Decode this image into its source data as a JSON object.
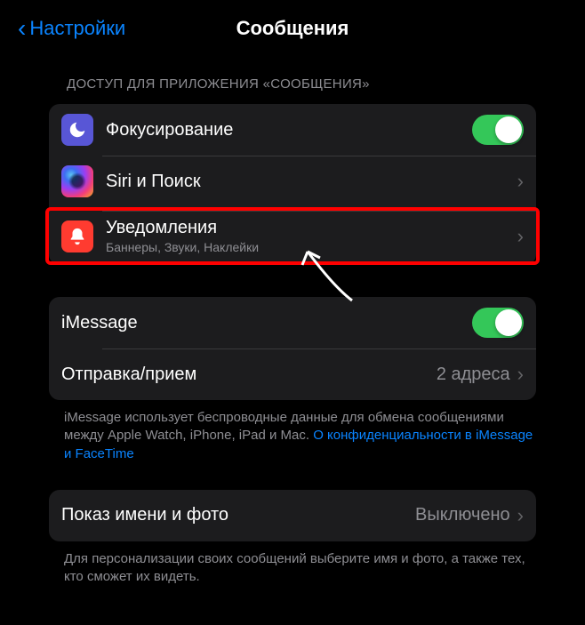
{
  "header": {
    "back_label": "Настройки",
    "title": "Сообщения"
  },
  "sections": {
    "access": {
      "header": "ДОСТУП ДЛЯ ПРИЛОЖЕНИЯ «СООБЩЕНИЯ»",
      "items": {
        "focus": {
          "label": "Фокусирование",
          "toggle_on": true
        },
        "siri": {
          "label": "Siri и Поиск"
        },
        "notifications": {
          "label": "Уведомления",
          "sublabel": "Баннеры, Звуки, Наклейки"
        }
      }
    },
    "imessage": {
      "items": {
        "imessage": {
          "label": "iMessage",
          "toggle_on": true
        },
        "send_receive": {
          "label": "Отправка/прием",
          "value": "2 адреса"
        }
      },
      "footer": {
        "text_before": "iMessage использует беспроводные данные для обмена сообщениями между Apple Watch, iPhone, iPad и Mac. ",
        "link": "О конфиденциальности в iMessage и FaceTime"
      }
    },
    "profile": {
      "items": {
        "name_photo": {
          "label": "Показ имени и фото",
          "value": "Выключено"
        }
      },
      "footer": "Для персонализации своих сообщений выберите имя и фото, а также тех, кто сможет их видеть."
    }
  }
}
